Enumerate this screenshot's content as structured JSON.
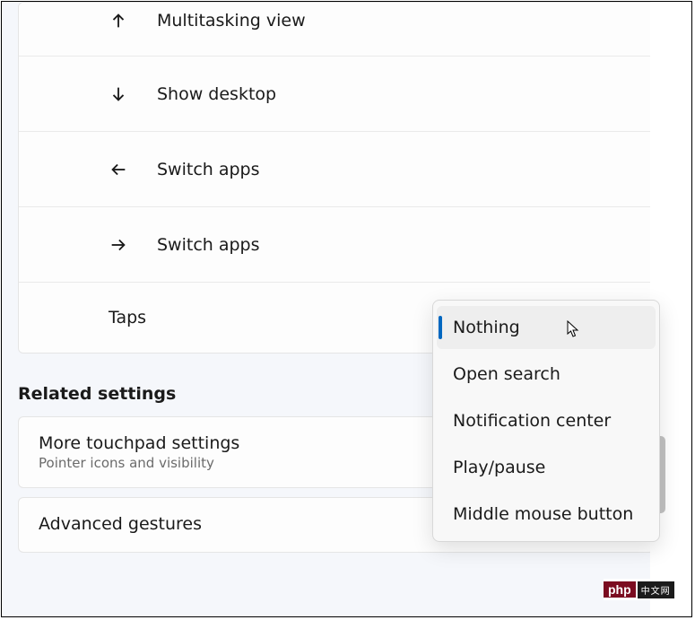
{
  "gestures": [
    {
      "label": "Multitasking view",
      "icon": "arrow-up"
    },
    {
      "label": "Show desktop",
      "icon": "arrow-down"
    },
    {
      "label": "Switch apps",
      "icon": "arrow-left"
    },
    {
      "label": "Switch apps",
      "icon": "arrow-right"
    }
  ],
  "taps": {
    "label": "Taps"
  },
  "dropdown": {
    "items": [
      "Nothing",
      "Open search",
      "Notification center",
      "Play/pause",
      "Middle mouse button"
    ],
    "selected_index": 0
  },
  "related": {
    "heading": "Related settings",
    "more_touchpad": {
      "title": "More touchpad settings",
      "subtitle": "Pointer icons and visibility"
    },
    "advanced_gestures": {
      "title": "Advanced gestures"
    }
  },
  "watermark": {
    "php": "php",
    "cn": "中文网"
  }
}
